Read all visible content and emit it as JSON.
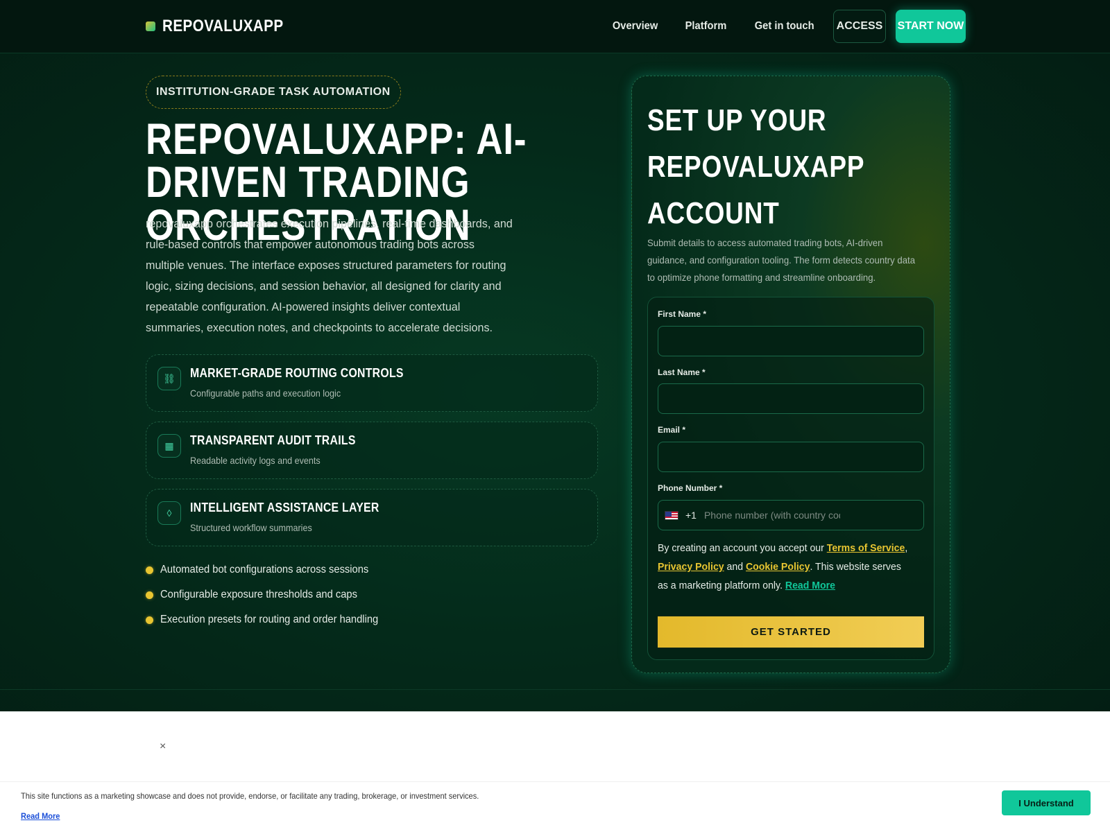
{
  "header": {
    "brand": "REPOVALUXAPP",
    "nav": [
      "Overview",
      "Platform",
      "Get in touch"
    ],
    "access_label": "ACCESS",
    "start_label": "START NOW"
  },
  "hero": {
    "badge": "INSTITUTION-GRADE TASK AUTOMATION",
    "title": "REPOVALUXAPP: AI-DRIVEN TRADING ORCHESTRATION",
    "description": "repovaluxapp orchestrates execution pipelines, real-time dashboards, and rule-based controls that empower autonomous trading bots across multiple venues. The interface exposes structured parameters for routing logic, sizing decisions, and session behavior, all designed for clarity and repeatable configuration. AI-powered insights deliver contextual summaries, execution notes, and checkpoints to accelerate decisions.",
    "features": [
      {
        "icon": "routing-icon",
        "glyph": "⛓",
        "title": "MARKET-GRADE ROUTING CONTROLS",
        "subtitle": "Configurable paths and execution logic"
      },
      {
        "icon": "grid-icon",
        "glyph": "▦",
        "title": "TRANSPARENT AUDIT TRAILS",
        "subtitle": "Readable activity logs and events"
      },
      {
        "icon": "diamond-icon",
        "glyph": "◊",
        "title": "INTELLIGENT ASSISTANCE LAYER",
        "subtitle": "Structured workflow summaries"
      }
    ],
    "bullets": [
      "Automated bot configurations across sessions",
      "Configurable exposure thresholds and caps",
      "Execution presets for routing and order handling"
    ]
  },
  "form": {
    "title": "SET UP YOUR REPOVALUXAPP ACCOUNT",
    "description": "Submit details to access automated trading bots, AI-driven guidance, and configuration tooling. The form detects country data to optimize phone formatting and streamline onboarding.",
    "first_name_label": "First Name *",
    "last_name_label": "Last Name *",
    "email_label": "Email *",
    "phone_label": "Phone Number *",
    "dial_code": "+1",
    "phone_placeholder": "Phone number (with country code",
    "terms_prefix": "By creating an account you accept our ",
    "terms_link": "Terms of Service",
    "comma": ",",
    "privacy_link": "Privacy Policy",
    "and": " and ",
    "cookie_link": "Cookie Policy",
    "terms_suffix": ". This website serves as a marketing platform only. ",
    "read_more": "Read More",
    "submit_label": "GET STARTED"
  },
  "cookie": {
    "close": "×",
    "text": "This site functions as a marketing showcase and does not provide, endorse, or facilitate any trading, brokerage, or investment services.",
    "read_more": "Read More",
    "button": "I Understand"
  },
  "colors": {
    "accent_teal": "#10c79a",
    "accent_gold": "#e8c531",
    "background": "#042a1a"
  }
}
